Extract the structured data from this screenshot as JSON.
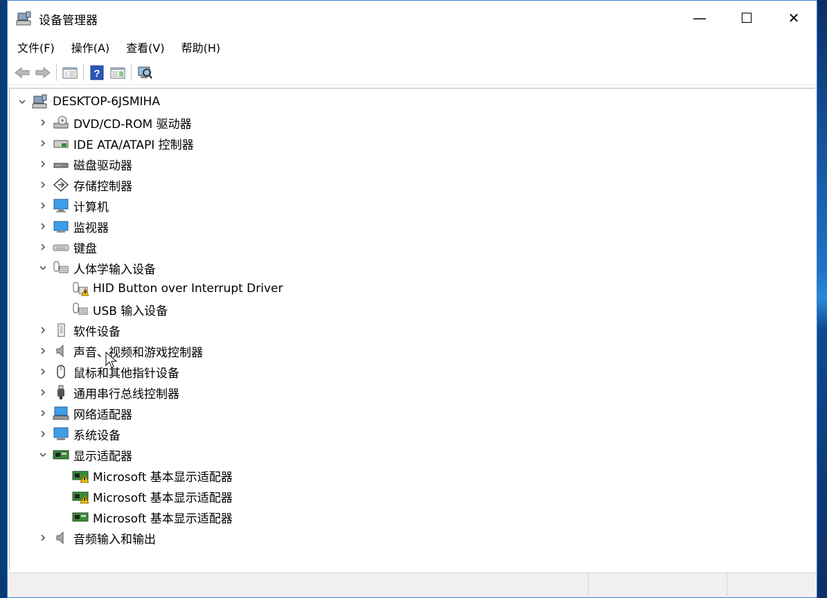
{
  "window": {
    "title": "设备管理器",
    "controls": {
      "minimize": "—",
      "maximize": "☐",
      "close": "✕"
    }
  },
  "menu": [
    {
      "label": "文件(F)"
    },
    {
      "label": "操作(A)"
    },
    {
      "label": "查看(V)"
    },
    {
      "label": "帮助(H)"
    }
  ],
  "tree": {
    "root": "DESKTOP-6JSMIHA",
    "categories": [
      {
        "label": "DVD/CD-ROM 驱动器",
        "icon": "dvd-drive-icon",
        "expanded": false
      },
      {
        "label": "IDE ATA/ATAPI 控制器",
        "icon": "ide-controller-icon",
        "expanded": false
      },
      {
        "label": "磁盘驱动器",
        "icon": "disk-drive-icon",
        "expanded": false
      },
      {
        "label": "存储控制器",
        "icon": "storage-controller-icon",
        "expanded": false
      },
      {
        "label": "计算机",
        "icon": "computer-icon",
        "expanded": false
      },
      {
        "label": "监视器",
        "icon": "monitor-icon",
        "expanded": false
      },
      {
        "label": "键盘",
        "icon": "keyboard-icon",
        "expanded": false
      },
      {
        "label": "人体学输入设备",
        "icon": "hid-icon",
        "expanded": true,
        "children": [
          {
            "label": "HID Button over Interrupt Driver",
            "icon": "hid-warning-icon"
          },
          {
            "label": "USB 输入设备",
            "icon": "hid-icon"
          }
        ]
      },
      {
        "label": "软件设备",
        "icon": "software-device-icon",
        "expanded": false
      },
      {
        "label": "声音、视频和游戏控制器",
        "icon": "speaker-icon",
        "expanded": false
      },
      {
        "label": "鼠标和其他指针设备",
        "icon": "mouse-icon",
        "expanded": false
      },
      {
        "label": "通用串行总线控制器",
        "icon": "usb-icon",
        "expanded": false
      },
      {
        "label": "网络适配器",
        "icon": "network-adapter-icon",
        "expanded": false
      },
      {
        "label": "系统设备",
        "icon": "system-device-icon",
        "expanded": false
      },
      {
        "label": "显示适配器",
        "icon": "display-adapter-icon",
        "expanded": true,
        "children": [
          {
            "label": "Microsoft 基本显示适配器",
            "icon": "display-adapter-warning-icon"
          },
          {
            "label": "Microsoft 基本显示适配器",
            "icon": "display-adapter-warning-icon"
          },
          {
            "label": "Microsoft 基本显示适配器",
            "icon": "display-adapter-icon"
          }
        ]
      },
      {
        "label": "音频输入和输出",
        "icon": "speaker-icon",
        "expanded": false
      }
    ]
  }
}
